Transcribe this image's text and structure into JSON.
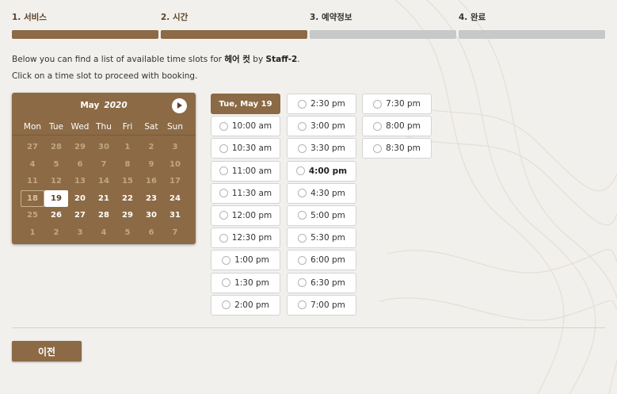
{
  "steps": [
    {
      "label": "1. 서비스",
      "state": "done"
    },
    {
      "label": "2. 시간",
      "state": "done"
    },
    {
      "label": "3. 예약정보",
      "state": "future"
    },
    {
      "label": "4. 완료",
      "state": "future"
    }
  ],
  "info": {
    "line1_prefix": "Below you can find a list of available time slots for ",
    "service": "헤어 컷",
    "by": " by ",
    "staff": "Staff-2",
    "period": ".",
    "line2": "Click on a time slot to proceed with booking."
  },
  "calendar": {
    "month": "May",
    "year": "2020",
    "days_of_week": [
      "Mon",
      "Tue",
      "Wed",
      "Thu",
      "Fri",
      "Sat",
      "Sun"
    ],
    "weeks": [
      [
        "27",
        "28",
        "29",
        "30",
        "1",
        "2",
        "3"
      ],
      [
        "4",
        "5",
        "6",
        "7",
        "8",
        "9",
        "10"
      ],
      [
        "11",
        "12",
        "13",
        "14",
        "15",
        "16",
        "17"
      ],
      [
        "18",
        "19",
        "20",
        "21",
        "22",
        "23",
        "24"
      ],
      [
        "25",
        "26",
        "27",
        "28",
        "29",
        "30",
        "31"
      ],
      [
        "1",
        "2",
        "3",
        "4",
        "5",
        "6",
        "7"
      ]
    ],
    "today": "18",
    "selected": "19"
  },
  "slots": {
    "date_header": "Tue, May 19",
    "column1": [
      "10:00 am",
      "10:30 am",
      "11:00 am",
      "11:30 am",
      "12:00 pm",
      "12:30 pm",
      "1:00 pm",
      "1:30 pm",
      "2:00 pm"
    ],
    "column2": [
      "2:30 pm",
      "3:00 pm",
      "3:30 pm",
      "4:00 pm",
      "4:30 pm",
      "5:00 pm",
      "5:30 pm",
      "6:00 pm",
      "6:30 pm",
      "7:00 pm"
    ],
    "column3": [
      "7:30 pm",
      "8:00 pm",
      "8:30 pm"
    ],
    "bold_slot": "4:00 pm"
  },
  "back_button": "이전",
  "colors": {
    "accent": "#8b6a45",
    "inactive_bar": "#c6c8ca",
    "background": "#f2f0ec"
  }
}
